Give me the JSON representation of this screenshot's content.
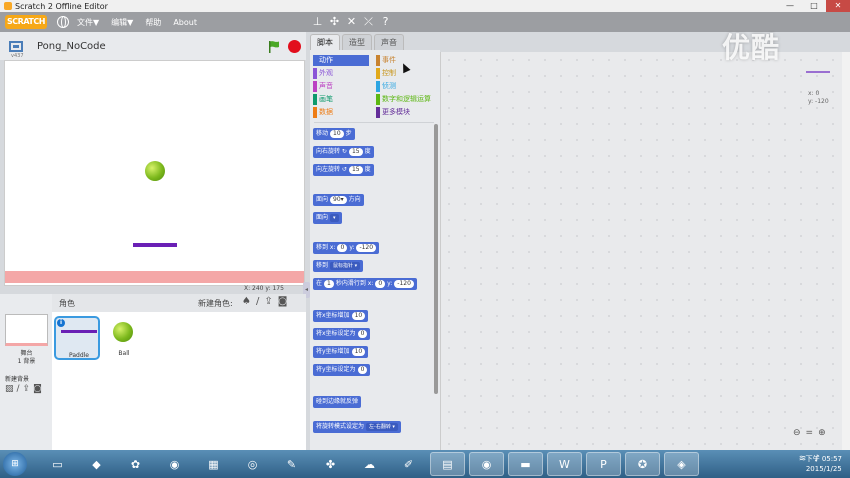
{
  "window": {
    "title": "Scratch 2 Offline Editor",
    "minimize": "—",
    "maximize": "□",
    "close": "✕"
  },
  "menubar": {
    "logo": "SCRATCH",
    "items": [
      "文件▼",
      "编辑▼",
      "帮助",
      "About"
    ]
  },
  "stage": {
    "project_name": "Pong_NoCode",
    "version": "v437",
    "coords_text": "X: 240   y: 175"
  },
  "sprites_panel": {
    "title": "角色",
    "new_sprite_label": "新建角色:",
    "stage_label": "舞台",
    "stage_backdrops": "1 背景",
    "new_backdrop_label": "新建背景",
    "sprites": [
      {
        "name": "Paddle",
        "selected": true
      },
      {
        "name": "Ball",
        "selected": false
      }
    ]
  },
  "tabs": [
    "脚本",
    "造型",
    "声音"
  ],
  "categories": [
    {
      "label": "动作",
      "color": "#4a6cd4",
      "active": true
    },
    {
      "label": "事件",
      "color": "#c88330"
    },
    {
      "label": "外观",
      "color": "#8a55d7"
    },
    {
      "label": "控制",
      "color": "#e1a91a"
    },
    {
      "label": "声音",
      "color": "#bb42c3"
    },
    {
      "label": "侦测",
      "color": "#2ca5e2"
    },
    {
      "label": "画笔",
      "color": "#0e9a6c"
    },
    {
      "label": "数字和逻辑运算",
      "color": "#5cb712"
    },
    {
      "label": "数据",
      "color": "#ee7d16"
    },
    {
      "label": "更多模块",
      "color": "#632d99"
    }
  ],
  "blocks": [
    {
      "text": "移动",
      "field": "10",
      "suffix": "步"
    },
    {
      "text": "向右旋转 ↻",
      "field": "15",
      "suffix": "度"
    },
    {
      "text": "向左旋转 ↺",
      "field": "15",
      "suffix": "度"
    },
    {
      "text": "面向",
      "field": "90▾",
      "suffix": "方向"
    },
    {
      "text": "面向",
      "dropdown": "▾"
    },
    {
      "text": "移到 x:",
      "field": "0",
      "mid": "y:",
      "field2": "-120"
    },
    {
      "text": "移到",
      "dropdown": "鼠标指针 ▾"
    },
    {
      "text": "在",
      "field": "1",
      "mid": "秒内滑行到 x:",
      "field2": "0",
      "mid2": "y:",
      "field3": "-120"
    },
    {
      "text": "将x坐标增加",
      "field": "10"
    },
    {
      "text": "将x坐标设定为",
      "field": "0"
    },
    {
      "text": "将y坐标增加",
      "field": "10"
    },
    {
      "text": "将y坐标设定为",
      "field": "0"
    },
    {
      "text": "碰到边缘就反弹"
    },
    {
      "text": "将旋转模式设定为",
      "dropdown": "左-右翻转 ▾"
    }
  ],
  "scripts_area": {
    "x_readout": "x: 0",
    "y_readout": "y: -120"
  },
  "watermark": "优酷",
  "taskbar": {
    "clock_time": "下午 05:57",
    "clock_date": "2015/1/25",
    "tasks": [
      "cmd-icon",
      "media-icon",
      "game-icon",
      "chrome-icon",
      "calc-icon",
      "disc-icon",
      "paint-icon",
      "network-icon",
      "cloud-icon",
      "pencil-icon",
      "notebook-icon",
      "chrome-icon",
      "folder-icon",
      "word-icon",
      "powerpoint-icon",
      "scratch-icon",
      "screenshot-icon"
    ]
  }
}
